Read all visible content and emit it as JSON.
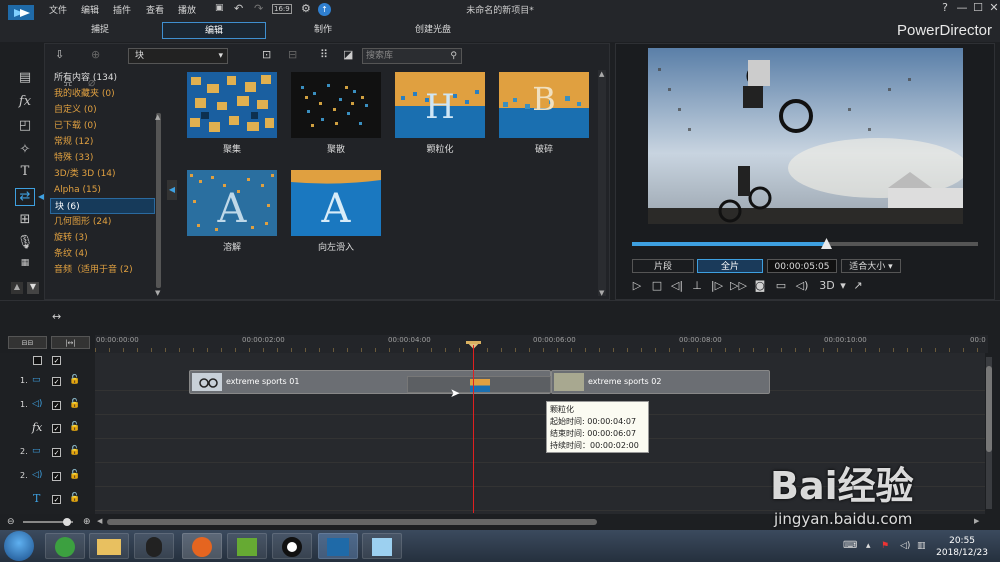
{
  "menubar": {
    "items": [
      "文件",
      "编辑",
      "插件",
      "查看",
      "播放"
    ],
    "doc_title": "未命名的新项目*",
    "help": "?"
  },
  "modes": {
    "tabs": [
      "捕捉",
      "编辑",
      "制作",
      "创建光盘"
    ],
    "active": "编辑",
    "brand": "PowerDirector"
  },
  "library": {
    "category_select": "块",
    "search_placeholder": "搜索库",
    "categories": [
      "所有内容 (134)",
      "我的收藏夹 (0)",
      "自定义 (0)",
      "已下载 (0)",
      "常规 (12)",
      "特殊 (33)",
      "3D/类 3D (14)",
      "Alpha (15)",
      "块 (6)",
      "几何图形 (24)",
      "旋转 (3)",
      "条纹 (4)",
      "音频（适用于音 (2)"
    ],
    "selected_category": "块 (6)",
    "items": [
      {
        "label": "聚集",
        "icon": "gather-thumb"
      },
      {
        "label": "聚散",
        "icon": "scatter-thumb"
      },
      {
        "label": "颗粒化",
        "icon": "granulate-thumb"
      },
      {
        "label": "破碎",
        "icon": "shatter-thumb"
      },
      {
        "label": "溶解",
        "icon": "dissolve-thumb"
      },
      {
        "label": "向左滑入",
        "icon": "slide-left-thumb"
      }
    ]
  },
  "preview": {
    "clip_label": "片段",
    "movie_label": "全片",
    "timecode": "00:00:05:05",
    "fit_label": "适合大小",
    "mode_3d": "3D",
    "progress": 0.56
  },
  "timeline": {
    "ruler": [
      "00:00:00:00",
      "00:00:02:00",
      "00:00:04:00",
      "00:00:06:00",
      "00:00:08:00",
      "00:00:10:00",
      "00:0"
    ],
    "tracks": [
      {
        "num": "1.",
        "icon": "video-track-icon"
      },
      {
        "num": "1.",
        "icon": "audio-track-icon"
      },
      {
        "num": "",
        "icon": "fx-track-icon"
      },
      {
        "num": "2.",
        "icon": "video-track-icon"
      },
      {
        "num": "2.",
        "icon": "audio-track-icon"
      },
      {
        "num": "",
        "icon": "title-track-icon"
      }
    ],
    "clip1": "extreme sports 01",
    "clip2": "extreme sports 02",
    "tooltip": {
      "title": "颗粒化",
      "start": "起始时间: 00:00:04:07",
      "end": "结束时间: 00:00:06:07",
      "duration": "持续时间：00:00:02:00"
    }
  },
  "taskbar": {
    "time": "20:55",
    "date": "2018/12/23"
  },
  "watermark": {
    "text": "Bai经验",
    "url": "jingyan.baidu.com"
  },
  "colors": {
    "accent": "#3ea0e0",
    "category": "#e0a040",
    "playhead": "#e02020"
  }
}
